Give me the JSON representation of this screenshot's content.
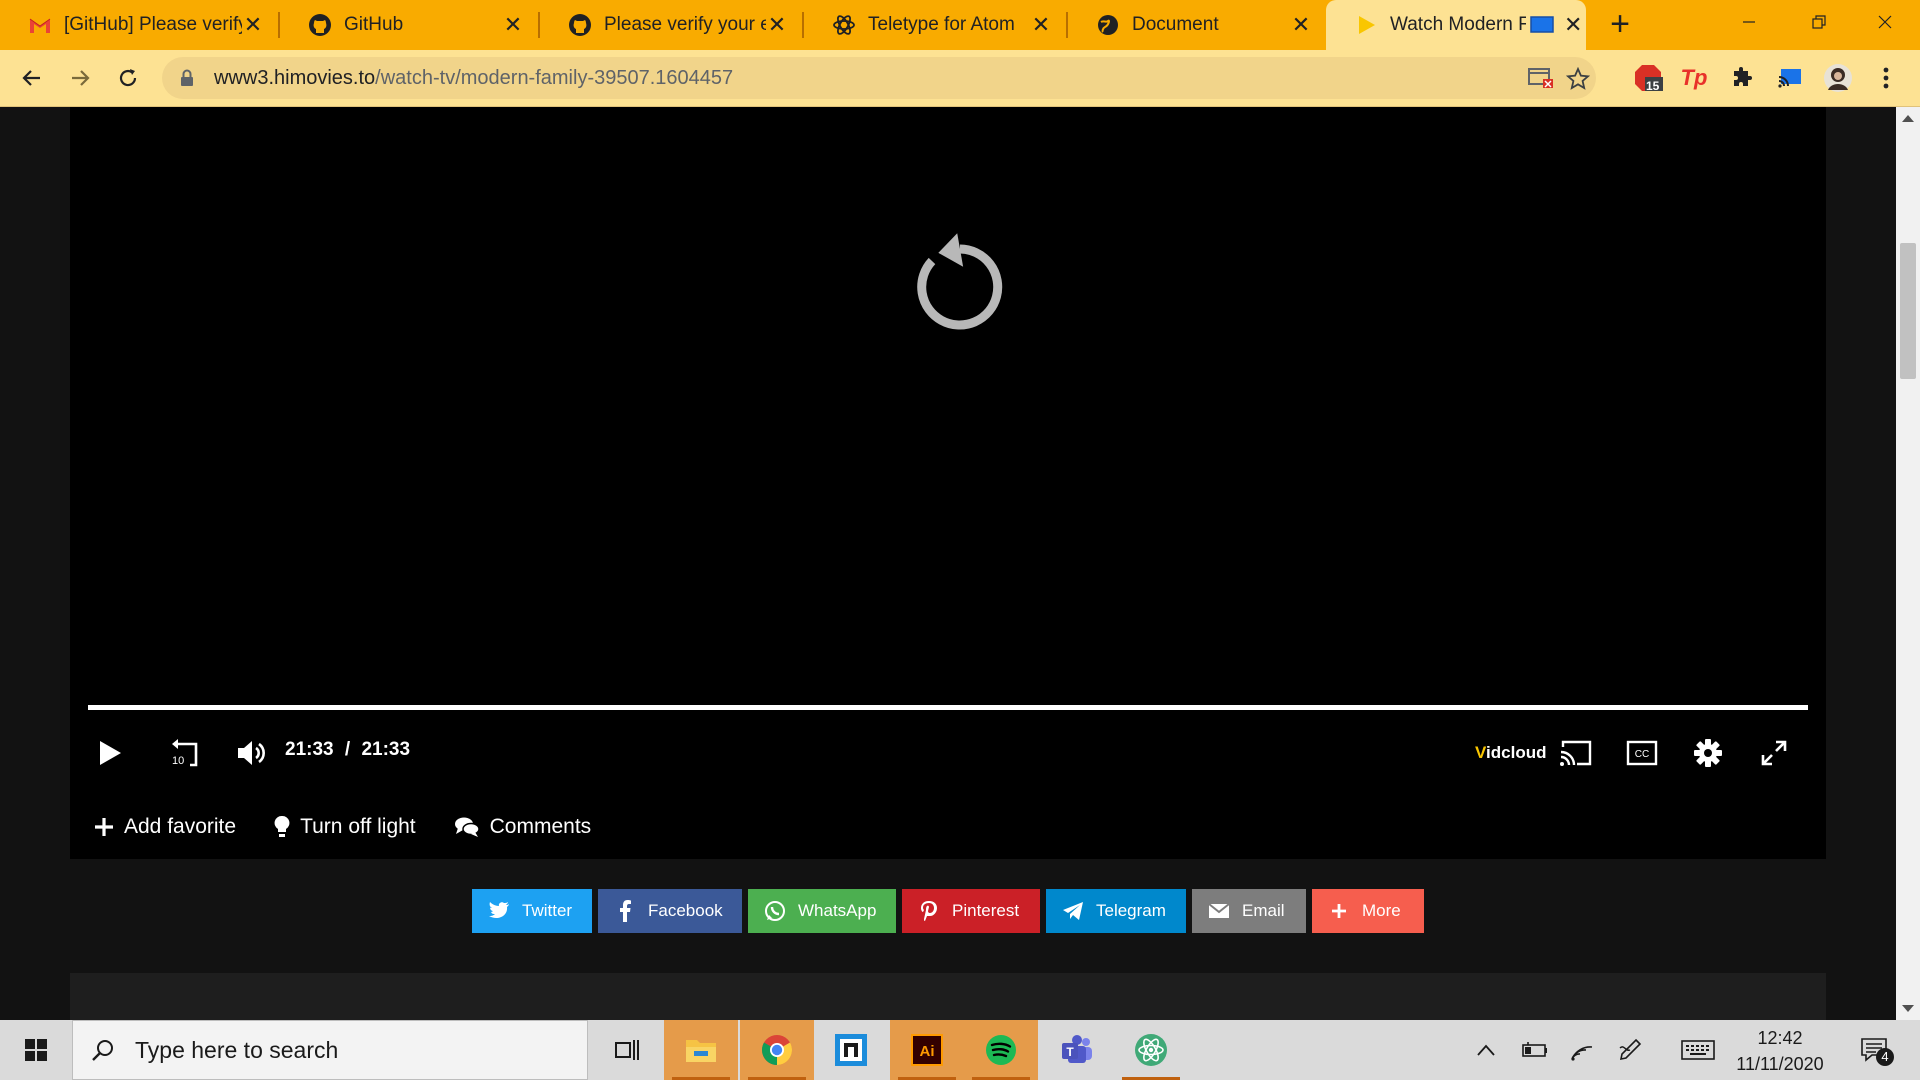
{
  "browser": {
    "tabs": [
      {
        "title": "[GitHub] Please verify your email",
        "icon": "gmail-icon",
        "active": false
      },
      {
        "title": "GitHub",
        "icon": "github-icon",
        "active": false
      },
      {
        "title": "Please verify your email",
        "icon": "github-icon",
        "active": false
      },
      {
        "title": "Teletype for Atom",
        "icon": "teletype-icon",
        "active": false
      },
      {
        "title": "Document",
        "icon": "globe-icon",
        "active": false
      },
      {
        "title": "Watch Modern Family",
        "icon": "play-favicon-icon",
        "active": true
      }
    ],
    "url_host": "www3.himovies.to",
    "url_path": "/watch-tv/modern-family-39507.1604457",
    "extension_badge": "15",
    "accent_color": "#f9ab00"
  },
  "player": {
    "time_current": "21:33",
    "time_separator": "/",
    "time_total": "21:33",
    "progress": 1.0,
    "skip_back_seconds": "10",
    "brand_v": "V",
    "brand_rest": "idcloud",
    "actions": {
      "add_favorite": "Add favorite",
      "turn_off_light": "Turn off light",
      "comments": "Comments"
    }
  },
  "share": [
    {
      "label": "Twitter",
      "color": "#1da1f2",
      "icon": "twitter-icon"
    },
    {
      "label": "Facebook",
      "color": "#3b5998",
      "icon": "facebook-icon"
    },
    {
      "label": "WhatsApp",
      "color": "#4caf50",
      "icon": "whatsapp-icon"
    },
    {
      "label": "Pinterest",
      "color": "#cb2027",
      "icon": "pinterest-icon"
    },
    {
      "label": "Telegram",
      "color": "#0088cc",
      "icon": "telegram-icon"
    },
    {
      "label": "Email",
      "color": "#7d7d7d",
      "icon": "email-icon"
    },
    {
      "label": "More",
      "color": "#f65e4e",
      "icon": "plus-icon"
    }
  ],
  "taskbar": {
    "search_placeholder": "Type here to search",
    "clock_time": "12:42",
    "clock_date": "11/11/2020",
    "notification_count": "4"
  }
}
